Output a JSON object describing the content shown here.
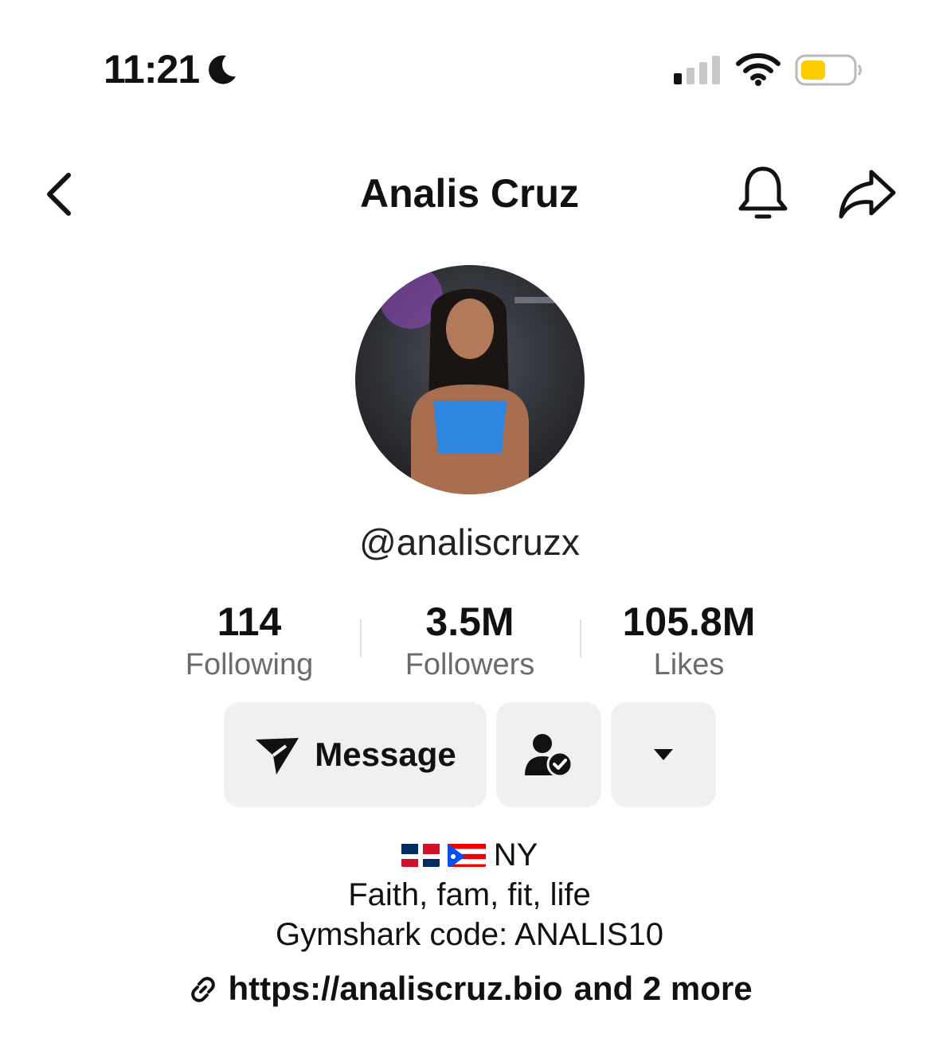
{
  "status_bar": {
    "time": "11:21",
    "moon_icon": "moon-icon",
    "signal_icon": "cellular-signal-icon",
    "wifi_icon": "wifi-icon",
    "battery_icon": "battery-icon",
    "battery_color": "#FFCC00"
  },
  "header": {
    "back_icon": "chevron-left-icon",
    "title": "Analis Cruz",
    "bell_icon": "bell-icon",
    "share_icon": "share-arrow-icon"
  },
  "profile": {
    "handle": "@analiscruzx",
    "stats": [
      {
        "value": "114",
        "label": "Following"
      },
      {
        "value": "3.5M",
        "label": "Followers"
      },
      {
        "value": "105.8M",
        "label": "Likes"
      }
    ]
  },
  "actions": {
    "message_label": "Message",
    "message_icon": "paper-plane-icon",
    "follow_icon": "person-check-icon",
    "more_icon": "caret-down-icon"
  },
  "bio": {
    "flags": [
      "dominican-republic-flag",
      "puerto-rico-flag"
    ],
    "location": "NY",
    "line2": "Faith, fam, fit, life",
    "line3": "Gymshark code: ANALIS10",
    "link": "https://analiscruz.bio",
    "link_more": "and 2 more",
    "link_icon": "link-icon"
  }
}
